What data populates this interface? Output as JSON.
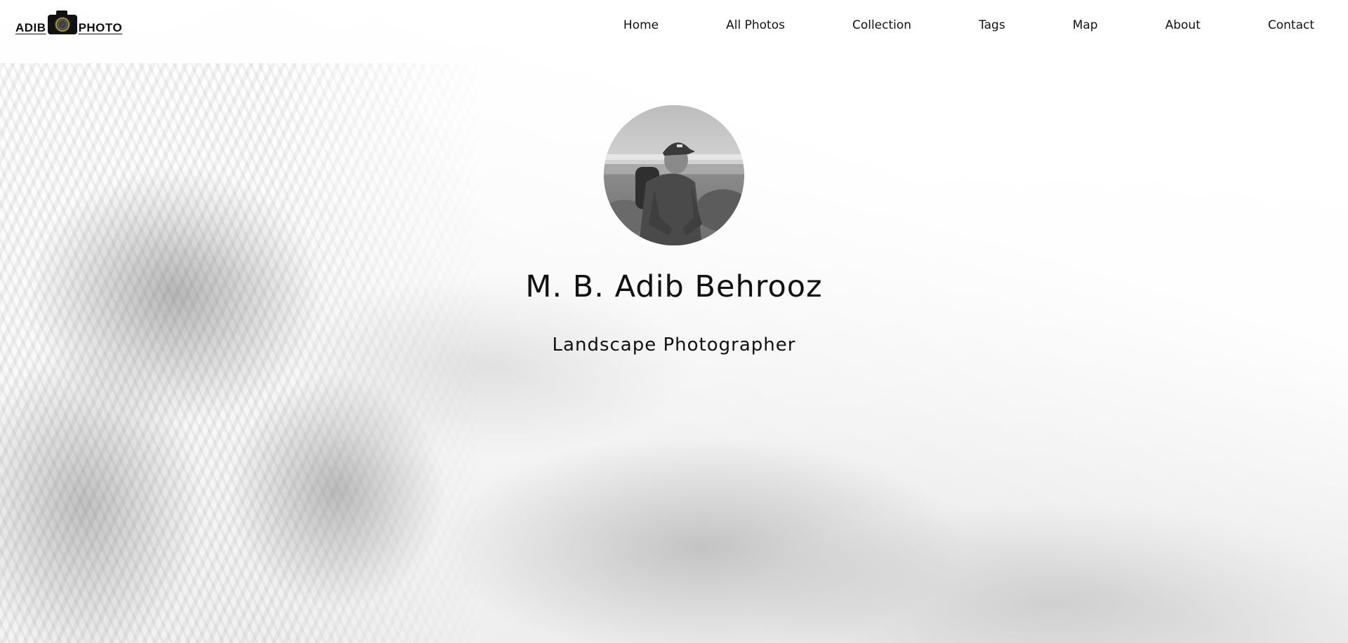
{
  "logo": {
    "text_left": "ADIB",
    "text_right": "PHOTO",
    "icon": "camera-icon"
  },
  "nav": {
    "items": [
      {
        "label": "Home"
      },
      {
        "label": "All Photos"
      },
      {
        "label": "Collection"
      },
      {
        "label": "Tags"
      },
      {
        "label": "Map"
      },
      {
        "label": "About"
      },
      {
        "label": "Contact"
      }
    ]
  },
  "profile": {
    "name": "M. B. Adib Behrooz",
    "title": "Landscape Photographer",
    "avatar_icon": "avatar-photo"
  },
  "colors": {
    "text": "#111111",
    "background": "#ffffff"
  }
}
